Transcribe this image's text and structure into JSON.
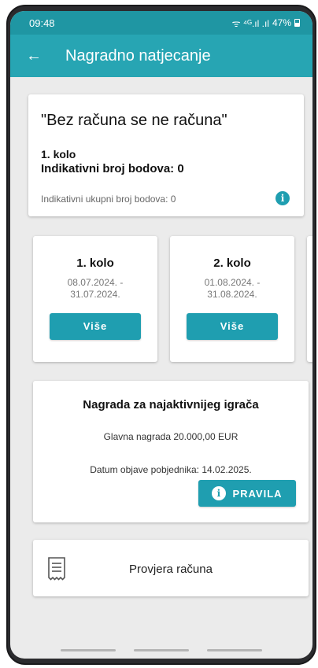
{
  "status_bar": {
    "time": "09:48",
    "signal": "ᯤ ⁴ᴳ.ıl .ıl",
    "battery": "47%"
  },
  "app_bar": {
    "back_icon": "arrow-left-icon",
    "title": "Nagradno natjecanje"
  },
  "campaign": {
    "title": "\"Bez računa se ne računa\"",
    "round": "1. kolo",
    "points_label": "Indikativni broj bodova: 0",
    "total_label": "Indikativni ukupni broj bodova: 0"
  },
  "rounds": [
    {
      "name": "1. kolo",
      "dates": "08.07.2024. -\n31.07.2024.",
      "button": "Više"
    },
    {
      "name": "2. kolo",
      "dates": "01.08.2024. -\n31.08.2024.",
      "button": "Više"
    }
  ],
  "prize": {
    "title": "Nagrada za najaktivnijeg igrača",
    "main_prize": "Glavna nagrada 20.000,00 EUR",
    "announce_date": "Datum objave pobjednika: 14.02.2025.",
    "rules_button": "PRAVILA"
  },
  "receipt_check": {
    "label": "Provjera računa",
    "icon": "receipt-icon"
  },
  "colors": {
    "accent": "#1f9eb0",
    "app_bar": "#27a5b3",
    "status_bar": "#1f96a3",
    "background": "#ebebeb"
  }
}
